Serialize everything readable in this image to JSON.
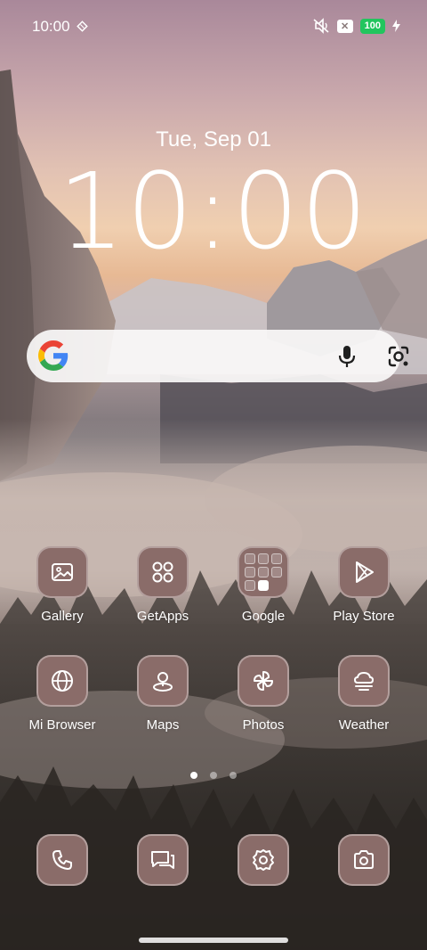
{
  "status_bar": {
    "time": "10:00",
    "battery": "100",
    "icons": [
      "diamond-icon",
      "mute-vibrate-icon",
      "no-sim-icon",
      "battery-icon",
      "charging-icon"
    ]
  },
  "lockclock": {
    "date": "Tue, Sep 01",
    "time": "10:00"
  },
  "search": {
    "icons": [
      "google-logo",
      "microphone-icon",
      "google-lens-icon"
    ]
  },
  "apps": [
    {
      "label": "Gallery",
      "icon": "gallery-icon"
    },
    {
      "label": "GetApps",
      "icon": "getapps-icon"
    },
    {
      "label": "Google",
      "icon": "google-folder-icon"
    },
    {
      "label": "Play Store",
      "icon": "play-store-icon"
    },
    {
      "label": "Mi Browser",
      "icon": "globe-icon"
    },
    {
      "label": "Maps",
      "icon": "map-pin-icon"
    },
    {
      "label": "Photos",
      "icon": "pinwheel-icon"
    },
    {
      "label": "Weather",
      "icon": "weather-icon"
    }
  ],
  "page_indicator": {
    "pages": 3,
    "current": 1
  },
  "dock": [
    "phone-icon",
    "messages-icon",
    "settings-icon",
    "camera-icon"
  ],
  "colors": {
    "icon_bg": "#8a6c69",
    "battery": "#22c55e"
  }
}
